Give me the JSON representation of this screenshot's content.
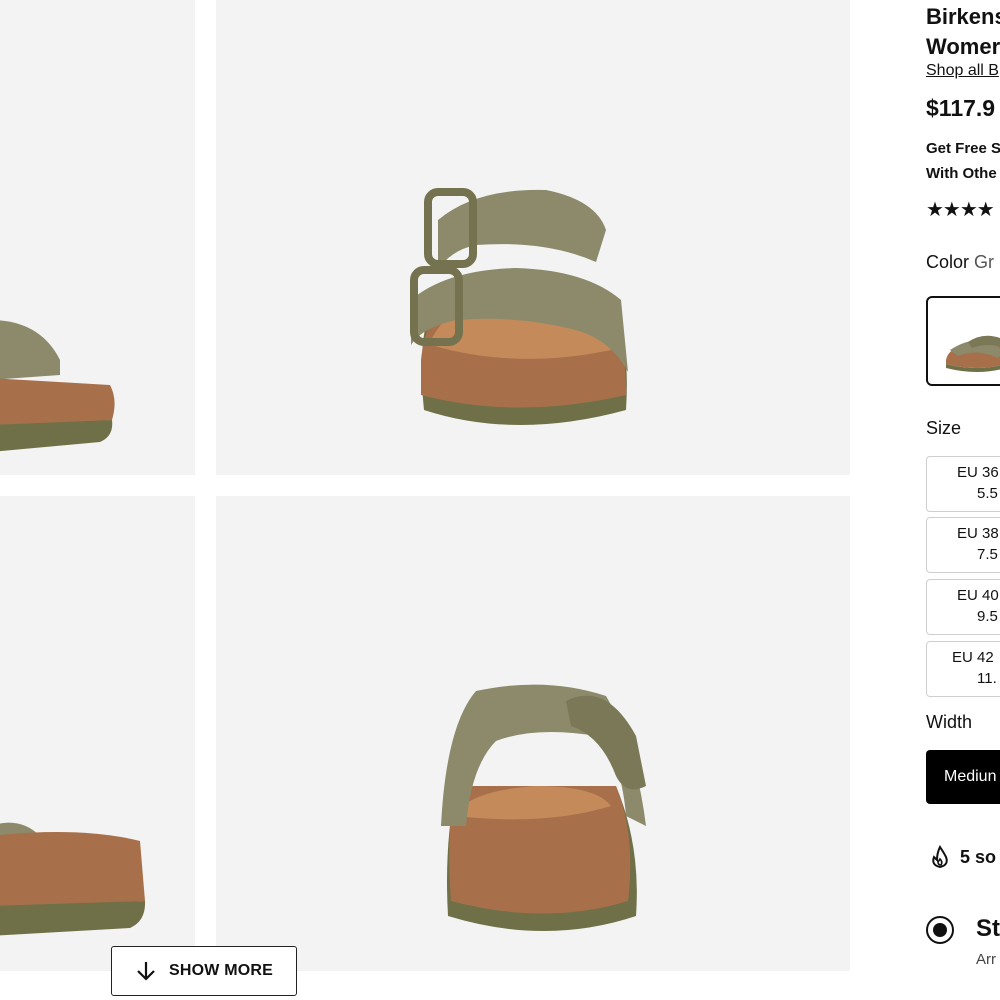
{
  "gallery": {
    "images": [
      {
        "alt": "sandal-side-left-top"
      },
      {
        "alt": "sandal-front-view"
      },
      {
        "alt": "sandal-side-left-bottom"
      },
      {
        "alt": "sandal-back-view"
      }
    ],
    "show_more_label": "SHOW MORE"
  },
  "product": {
    "title_line1": "Birkens",
    "title_line2": "Womer",
    "shop_all": "Shop all B",
    "price": "$117.9",
    "promo_line1": "Get Free S",
    "promo_line2": "With Othe",
    "rating_stars": "★★★★",
    "color_label": "Color",
    "color_value": "Gr",
    "size_label": "Size",
    "sizes": [
      {
        "eu": "EU 36",
        "us": "5.5"
      },
      {
        "eu": "EU 38",
        "us": "7.5"
      },
      {
        "eu": "EU 40",
        "us": "9.5"
      },
      {
        "eu": "EU 42",
        "us": "11."
      }
    ],
    "width_label": "Width",
    "width_selected": "Mediun",
    "sold_text": "5 so",
    "shipping_title": "St",
    "shipping_sub": "Arr"
  },
  "colors": {
    "background_tile": "#f3f3f3",
    "strap": "#8c8a6a",
    "cork": "#a8704a",
    "sole": "#6f7048"
  }
}
